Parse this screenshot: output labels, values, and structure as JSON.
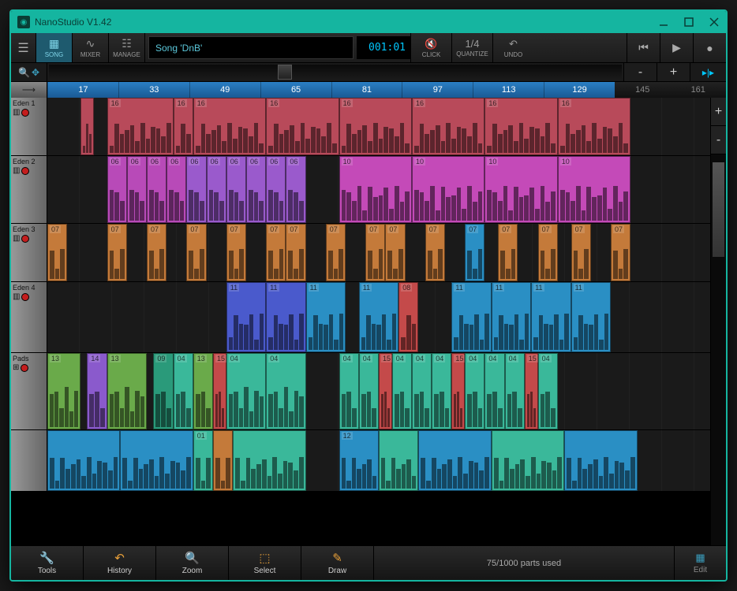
{
  "app": {
    "title": "NanoStudio V1.42"
  },
  "toolbar": {
    "song_btn": "SONG",
    "mixer_btn": "MIXER",
    "manage_btn": "MANAGE",
    "song_name": "Song 'DnB'",
    "timecode": "001:01",
    "click_btn": "CLICK",
    "quantize_label": "QUANTIZE",
    "quantize_val": "1/4",
    "undo_btn": "UNDO"
  },
  "zoom": {
    "minus": "-",
    "plus": "+"
  },
  "ruler": {
    "marks": [
      "17",
      "33",
      "49",
      "65",
      "81",
      "97",
      "113",
      "129"
    ],
    "dark_marks": [
      "145",
      "161"
    ]
  },
  "tracks": [
    {
      "name": "Eden 1",
      "icon": "keys",
      "clips": [
        {
          "l": 5,
          "w": 2,
          "c": "#b84a5a",
          "lbl": ""
        },
        {
          "l": 9,
          "w": 10,
          "c": "#b84a5a",
          "lbl": "16"
        },
        {
          "l": 19,
          "w": 3,
          "c": "#b84a5a",
          "lbl": "16"
        },
        {
          "l": 22,
          "w": 11,
          "c": "#b84a5a",
          "lbl": "16"
        },
        {
          "l": 33,
          "w": 11,
          "c": "#b84a5a",
          "lbl": "16"
        },
        {
          "l": 44,
          "w": 11,
          "c": "#b84a5a",
          "lbl": "16"
        },
        {
          "l": 55,
          "w": 11,
          "c": "#b84a5a",
          "lbl": "16"
        },
        {
          "l": 66,
          "w": 11,
          "c": "#b84a5a",
          "lbl": "16"
        },
        {
          "l": 77,
          "w": 11,
          "c": "#b84a5a",
          "lbl": "16"
        }
      ]
    },
    {
      "name": "Eden 2",
      "icon": "keys",
      "clips": [
        {
          "l": 9,
          "w": 3,
          "c": "#b84ab8",
          "lbl": "06"
        },
        {
          "l": 12,
          "w": 3,
          "c": "#b84ab8",
          "lbl": "06"
        },
        {
          "l": 15,
          "w": 3,
          "c": "#b84ab8",
          "lbl": "06"
        },
        {
          "l": 18,
          "w": 3,
          "c": "#b84ab8",
          "lbl": "06"
        },
        {
          "l": 21,
          "w": 3,
          "c": "#9a5acc",
          "lbl": "06"
        },
        {
          "l": 24,
          "w": 3,
          "c": "#9a5acc",
          "lbl": "06"
        },
        {
          "l": 27,
          "w": 3,
          "c": "#9a5acc",
          "lbl": "06"
        },
        {
          "l": 30,
          "w": 3,
          "c": "#9a5acc",
          "lbl": "06"
        },
        {
          "l": 33,
          "w": 3,
          "c": "#9a5acc",
          "lbl": "06"
        },
        {
          "l": 36,
          "w": 3,
          "c": "#9a5acc",
          "lbl": "06"
        },
        {
          "l": 44,
          "w": 11,
          "c": "#c44ab8",
          "lbl": "10"
        },
        {
          "l": 55,
          "w": 11,
          "c": "#c44ab8",
          "lbl": "10"
        },
        {
          "l": 66,
          "w": 11,
          "c": "#c44ab8",
          "lbl": "10"
        },
        {
          "l": 77,
          "w": 11,
          "c": "#c44ab8",
          "lbl": "10"
        }
      ]
    },
    {
      "name": "Eden 3",
      "icon": "keys",
      "clips": [
        {
          "l": 0,
          "w": 3,
          "c": "#c47a3a",
          "lbl": "07"
        },
        {
          "l": 9,
          "w": 3,
          "c": "#c47a3a",
          "lbl": "07"
        },
        {
          "l": 15,
          "w": 3,
          "c": "#c47a3a",
          "lbl": "07"
        },
        {
          "l": 21,
          "w": 3,
          "c": "#c47a3a",
          "lbl": "07"
        },
        {
          "l": 27,
          "w": 3,
          "c": "#c47a3a",
          "lbl": "07"
        },
        {
          "l": 33,
          "w": 3,
          "c": "#c47a3a",
          "lbl": "07"
        },
        {
          "l": 36,
          "w": 3,
          "c": "#c47a3a",
          "lbl": "07"
        },
        {
          "l": 42,
          "w": 3,
          "c": "#c47a3a",
          "lbl": "07"
        },
        {
          "l": 48,
          "w": 3,
          "c": "#c47a3a",
          "lbl": "07"
        },
        {
          "l": 51,
          "w": 3,
          "c": "#c47a3a",
          "lbl": "07"
        },
        {
          "l": 57,
          "w": 3,
          "c": "#c47a3a",
          "lbl": "07"
        },
        {
          "l": 63,
          "w": 3,
          "c": "#2a8fc4",
          "lbl": "07"
        },
        {
          "l": 68,
          "w": 3,
          "c": "#c47a3a",
          "lbl": "07"
        },
        {
          "l": 74,
          "w": 3,
          "c": "#c47a3a",
          "lbl": "07"
        },
        {
          "l": 79,
          "w": 3,
          "c": "#c47a3a",
          "lbl": "07"
        },
        {
          "l": 85,
          "w": 3,
          "c": "#c47a3a",
          "lbl": "07"
        }
      ]
    },
    {
      "name": "Eden 4",
      "icon": "keys",
      "clips": [
        {
          "l": 27,
          "w": 6,
          "c": "#4a5acc",
          "lbl": "11"
        },
        {
          "l": 33,
          "w": 6,
          "c": "#4a5acc",
          "lbl": "11"
        },
        {
          "l": 39,
          "w": 6,
          "c": "#2a8fc4",
          "lbl": "11"
        },
        {
          "l": 47,
          "w": 6,
          "c": "#2a8fc4",
          "lbl": "11"
        },
        {
          "l": 53,
          "w": 3,
          "c": "#c44a4a",
          "lbl": "08"
        },
        {
          "l": 61,
          "w": 6,
          "c": "#2a8fc4",
          "lbl": "11"
        },
        {
          "l": 67,
          "w": 6,
          "c": "#2a8fc4",
          "lbl": "11"
        },
        {
          "l": 73,
          "w": 6,
          "c": "#2a8fc4",
          "lbl": "11"
        },
        {
          "l": 79,
          "w": 6,
          "c": "#2a8fc4",
          "lbl": "11"
        }
      ]
    },
    {
      "name": "Pads",
      "icon": "grid",
      "clips": [
        {
          "l": 0,
          "w": 5,
          "c": "#6aaa4a",
          "lbl": "13"
        },
        {
          "l": 6,
          "w": 3,
          "c": "#8a5acc",
          "lbl": "14"
        },
        {
          "l": 9,
          "w": 6,
          "c": "#6aaa4a",
          "lbl": "13"
        },
        {
          "l": 16,
          "w": 3,
          "c": "#2a9a7a",
          "lbl": "09"
        },
        {
          "l": 19,
          "w": 3,
          "c": "#3ab89a",
          "lbl": "04"
        },
        {
          "l": 22,
          "w": 3,
          "c": "#6aaa4a",
          "lbl": "13"
        },
        {
          "l": 25,
          "w": 2,
          "c": "#c44a4a",
          "lbl": "15"
        },
        {
          "l": 27,
          "w": 6,
          "c": "#3ab89a",
          "lbl": "04"
        },
        {
          "l": 33,
          "w": 6,
          "c": "#3ab89a",
          "lbl": "04"
        },
        {
          "l": 44,
          "w": 3,
          "c": "#3ab89a",
          "lbl": "04"
        },
        {
          "l": 47,
          "w": 3,
          "c": "#3ab89a",
          "lbl": "04"
        },
        {
          "l": 50,
          "w": 2,
          "c": "#c44a4a",
          "lbl": "15"
        },
        {
          "l": 52,
          "w": 3,
          "c": "#3ab89a",
          "lbl": "04"
        },
        {
          "l": 55,
          "w": 3,
          "c": "#3ab89a",
          "lbl": "04"
        },
        {
          "l": 58,
          "w": 3,
          "c": "#3ab89a",
          "lbl": "04"
        },
        {
          "l": 61,
          "w": 2,
          "c": "#c44a4a",
          "lbl": "15"
        },
        {
          "l": 63,
          "w": 3,
          "c": "#3ab89a",
          "lbl": "04"
        },
        {
          "l": 66,
          "w": 3,
          "c": "#3ab89a",
          "lbl": "04"
        },
        {
          "l": 69,
          "w": 3,
          "c": "#3ab89a",
          "lbl": "04"
        },
        {
          "l": 72,
          "w": 2,
          "c": "#c44a4a",
          "lbl": "15"
        },
        {
          "l": 74,
          "w": 3,
          "c": "#3ab89a",
          "lbl": "04"
        }
      ]
    },
    {
      "name": "",
      "icon": "",
      "clips": [
        {
          "l": 0,
          "w": 11,
          "c": "#2a8fc4",
          "lbl": ""
        },
        {
          "l": 11,
          "w": 11,
          "c": "#2a8fc4",
          "lbl": ""
        },
        {
          "l": 22,
          "w": 3,
          "c": "#3ab89a",
          "lbl": "01"
        },
        {
          "l": 25,
          "w": 3,
          "c": "#c47a3a",
          "lbl": ""
        },
        {
          "l": 28,
          "w": 11,
          "c": "#3ab89a",
          "lbl": ""
        },
        {
          "l": 44,
          "w": 6,
          "c": "#2a8fc4",
          "lbl": "12"
        },
        {
          "l": 50,
          "w": 6,
          "c": "#3ab89a",
          "lbl": ""
        },
        {
          "l": 56,
          "w": 11,
          "c": "#2a8fc4",
          "lbl": ""
        },
        {
          "l": 67,
          "w": 11,
          "c": "#3ab89a",
          "lbl": ""
        },
        {
          "l": 78,
          "w": 11,
          "c": "#2a8fc4",
          "lbl": ""
        }
      ]
    }
  ],
  "bottom": {
    "tools": "Tools",
    "history": "History",
    "zoom": "Zoom",
    "select": "Select",
    "draw": "Draw",
    "status": "75/1000 parts used",
    "edit": "Edit"
  }
}
